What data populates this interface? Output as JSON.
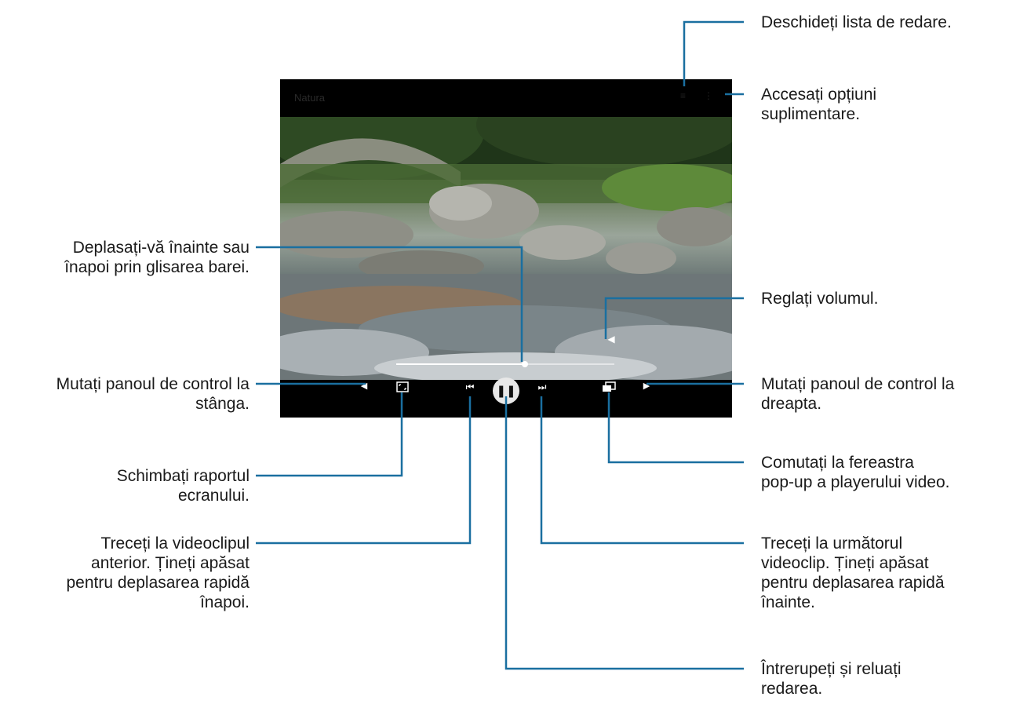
{
  "player": {
    "title": "Natura",
    "progress": 0.59,
    "volume_icon": "speaker-icon"
  },
  "controls": [
    {
      "name": "move-panel-left-button",
      "icon": "triangle-left-icon"
    },
    {
      "name": "aspect-ratio-button",
      "icon": "aspect-ratio-icon"
    },
    {
      "name": "previous-button",
      "icon": "skip-previous-icon"
    },
    {
      "name": "play-pause-button",
      "icon": "pause-icon"
    },
    {
      "name": "next-button",
      "icon": "skip-next-icon"
    },
    {
      "name": "popup-player-button",
      "icon": "popup-window-icon"
    },
    {
      "name": "move-panel-right-button",
      "icon": "triangle-right-icon"
    }
  ],
  "callouts": {
    "playlist": "Deschideți lista de redare.",
    "more_options_1": "Accesați opțiuni",
    "more_options_2": "suplimentare.",
    "seek_1": "Deplasați-vă înainte sau",
    "seek_2": "înapoi prin glisarea barei.",
    "volume": "Reglați volumul.",
    "move_left_1": "Mutați panoul de control la",
    "move_left_2": "stânga.",
    "move_right_1": "Mutați panoul de control la",
    "move_right_2": "dreapta.",
    "ratio_1": "Schimbați raportul",
    "ratio_2": "ecranului.",
    "popup_1": "Comutați la fereastra",
    "popup_2": "pop-up a playerului video.",
    "prev_1": "Treceți la videoclipul",
    "prev_2": "anterior. Țineți apăsat",
    "prev_3": "pentru deplasarea rapidă",
    "prev_4": "înapoi.",
    "next_1": "Treceți la următorul",
    "next_2": "videoclip. Țineți apăsat",
    "next_3": "pentru deplasarea rapidă",
    "next_4": "înainte.",
    "pause_1": "Întrerupeți și reluați",
    "pause_2": "redarea."
  },
  "colors": {
    "callout_line": "#1a6fa0",
    "accent": "#ffffff"
  }
}
